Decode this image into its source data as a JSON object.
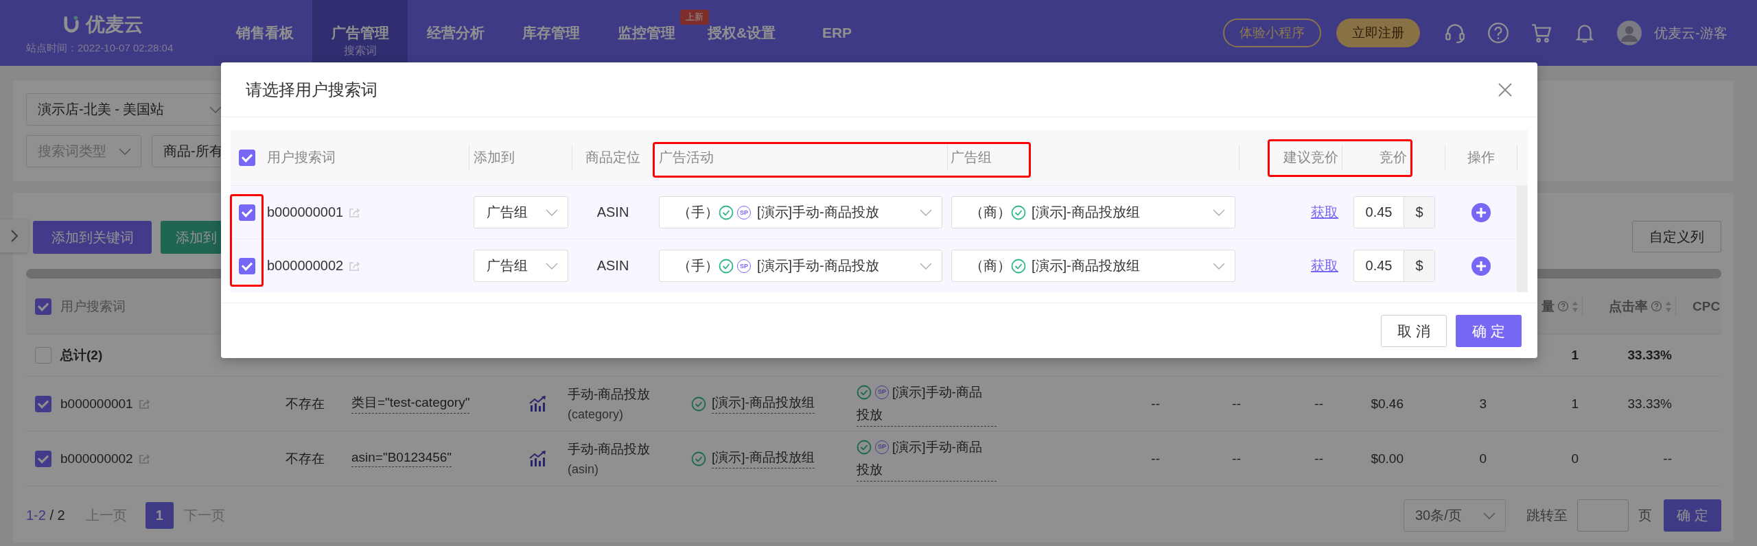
{
  "nav": {
    "logo": "优麦云",
    "site_time": "站点时间：2022-10-07 02:28:04",
    "menu": [
      {
        "label": "销售看板",
        "selected": false
      },
      {
        "label": "广告管理",
        "selected": true,
        "sub": "搜索词"
      },
      {
        "label": "经营分析",
        "selected": false
      },
      {
        "label": "库存管理",
        "selected": false
      },
      {
        "label": "监控管理",
        "selected": false,
        "badge": "上新"
      },
      {
        "label": "授权&设置",
        "selected": false
      },
      {
        "label": "ERP",
        "selected": false
      }
    ],
    "buttons": [
      {
        "label": "体验小程序",
        "kind": "outline"
      },
      {
        "label": "立即注册",
        "kind": "solid"
      }
    ],
    "user": "优麦云-游客"
  },
  "filters": {
    "store": "演示店-北美 - 美国站",
    "term_type_placeholder": "搜索词类型",
    "product": "商品-所有"
  },
  "actions": [
    {
      "label": "添加到关键词",
      "kind": "primary"
    },
    {
      "label": "添加到",
      "kind": "success"
    }
  ],
  "columns_button": "自定义列",
  "table": {
    "all_checked": true,
    "term_header": "用户搜索词",
    "right_headers": [
      {
        "label": "量",
        "help": true,
        "sortable": true
      },
      {
        "label": "点击率",
        "help": true,
        "sortable": true
      },
      {
        "label": "CPC"
      }
    ],
    "total": {
      "label": "总计(2)",
      "checked": false,
      "clicks": "1",
      "ctr": "33.33%"
    },
    "rows": [
      {
        "checked": true,
        "term": "b000000001",
        "status": "不存在",
        "targeting": "类目=\"test-category\"",
        "type": "手动-商品投放",
        "type_detail": "(category)",
        "group": "[演示]-商品投放组",
        "campaign_badge": "SP",
        "campaign_lines": [
          "[演示]手动-商品",
          "投放"
        ],
        "metrics": [
          "--",
          "--",
          "--",
          "$0.46",
          "3",
          "1",
          "33.33%"
        ]
      },
      {
        "checked": true,
        "term": "b000000002",
        "status": "不存在",
        "targeting": "asin=\"B0123456\"",
        "type": "手动-商品投放",
        "type_detail": "(asin)",
        "group": "[演示]-商品投放组",
        "campaign_badge": "SP",
        "campaign_lines": [
          "[演示]手动-商品",
          "投放"
        ],
        "metrics": [
          "--",
          "--",
          "--",
          "$0.00",
          "0",
          "0",
          "--"
        ]
      }
    ]
  },
  "pagination": {
    "range": "1-2",
    "total": "/ 2",
    "prev": "上一页",
    "pages": [
      {
        "label": "1",
        "selected": true
      }
    ],
    "next": "下一页",
    "page_size": "30条/页",
    "jump_label": "跳转至",
    "page_unit": "页",
    "go": "确 定"
  },
  "dialog": {
    "title": "请选择用户搜索词",
    "all_checked": true,
    "columns": [
      "用户搜索词",
      "添加到",
      "商品定位",
      "广告活动",
      "广告组",
      "建议竞价",
      "竞价",
      "操作"
    ],
    "rows": [
      {
        "checked": true,
        "term": "b000000001",
        "add_to": "广告组",
        "targeting": "ASIN",
        "campaign_prefix": "（手）",
        "campaign_badge": "SP",
        "campaign": "[演示]手动-商品投放",
        "group_prefix": "（商）",
        "group": "[演示]-商品投放组",
        "suggest": "获取",
        "bid": "0.45",
        "currency": "$"
      },
      {
        "checked": true,
        "term": "b000000002",
        "add_to": "广告组",
        "targeting": "ASIN",
        "campaign_prefix": "（手）",
        "campaign_badge": "SP",
        "campaign": "[演示]手动-商品投放",
        "group_prefix": "（商）",
        "group": "[演示]-商品投放组",
        "suggest": "获取",
        "bid": "0.45",
        "currency": "$"
      }
    ],
    "buttons": [
      {
        "label": "取 消",
        "kind": "default"
      },
      {
        "label": "确 定",
        "kind": "primary"
      }
    ]
  }
}
